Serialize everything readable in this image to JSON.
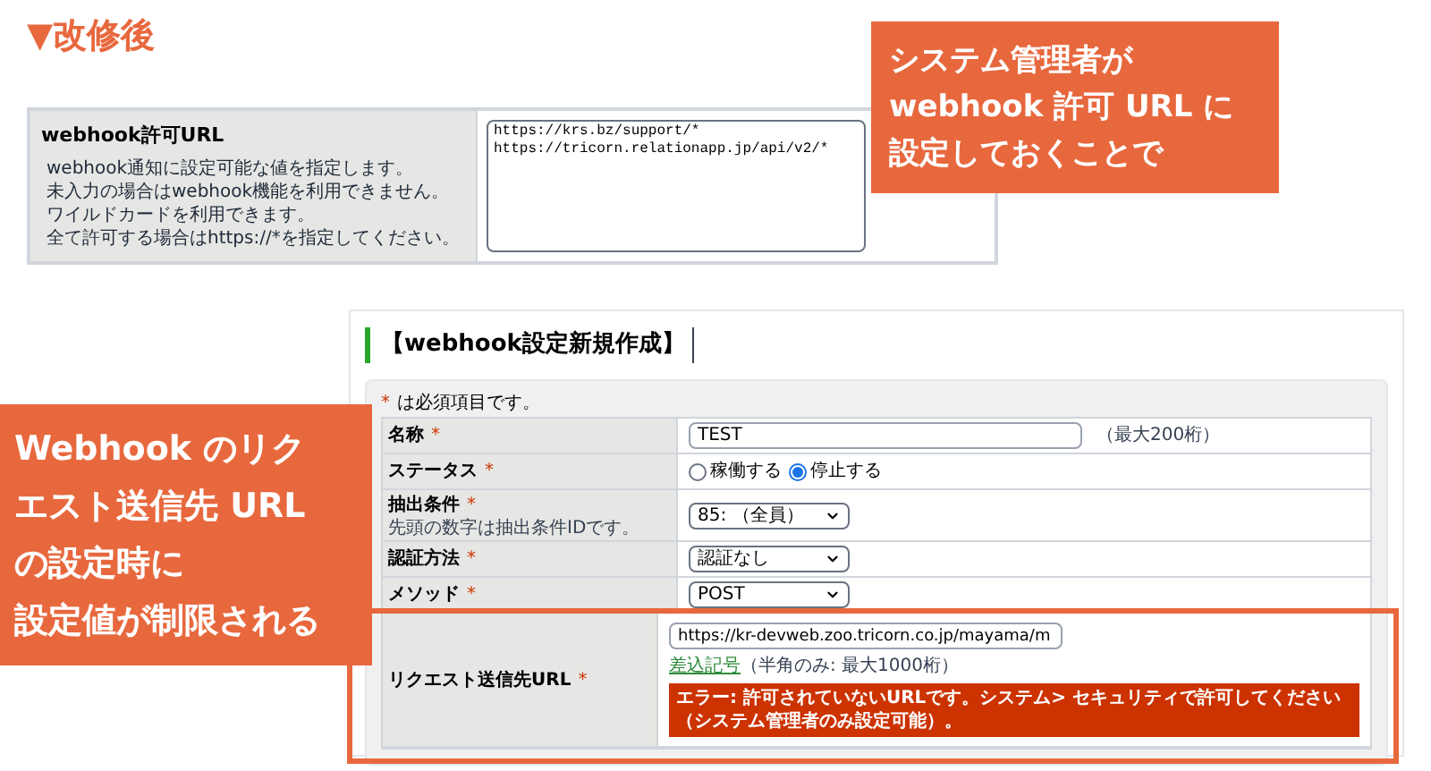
{
  "heading": "▼改修後",
  "allowed_url_panel": {
    "label": "webhook許可URL",
    "description": [
      "webhook通知に設定可能な値を指定します。",
      "未入力の場合はwebhook機能を利用できません。",
      "ワイルドカードを利用できます。",
      "全て許可する場合はhttps://*を指定してください。"
    ],
    "value": "https://krs.bz/support/*\nhttps://tricorn.relationapp.jp/api/v2/*"
  },
  "callouts": [
    {
      "lines": [
        "システム管理者が",
        "webhook 許可 URL に",
        "設定しておくことで"
      ]
    },
    {
      "lines": [
        "Webhook のリク",
        "エスト送信先 URL",
        "の設定時に",
        "設定値が制限される"
      ]
    }
  ],
  "form": {
    "title": "【webhook設定新規作成】",
    "required_mark": "*",
    "required_note": "は必須項目です。",
    "rows": [
      {
        "kind": "text",
        "label": "名称",
        "mark": "*",
        "value": "TEST",
        "suffix": "（最大200桁）"
      },
      {
        "kind": "radio",
        "label": "ステータス",
        "mark": "*",
        "options": [
          {
            "label": "稼働する",
            "selected": false
          },
          {
            "label": "停止する",
            "selected": true
          }
        ]
      },
      {
        "kind": "select",
        "label": "抽出条件",
        "mark": "*",
        "sublabel": "先頭の数字は抽出条件IDです。",
        "value": "85: （全員）"
      },
      {
        "kind": "select",
        "label": "認証方法",
        "mark": "*",
        "value": "認証なし"
      },
      {
        "kind": "select",
        "label": "メソッド",
        "mark": "*",
        "value": "POST"
      },
      {
        "kind": "url",
        "label": "リクエスト送信先URL",
        "mark": "*",
        "value": "https://kr-devweb.zoo.tricorn.co.jp/mayama/m",
        "link": "差込記号",
        "hint": "（半角のみ: 最大1000桁）",
        "error": "エラー: 許可されていないURLです。システム> セキュリティで許可してください（システム管理者のみ設定可能）。",
        "highlighted": true
      }
    ]
  }
}
